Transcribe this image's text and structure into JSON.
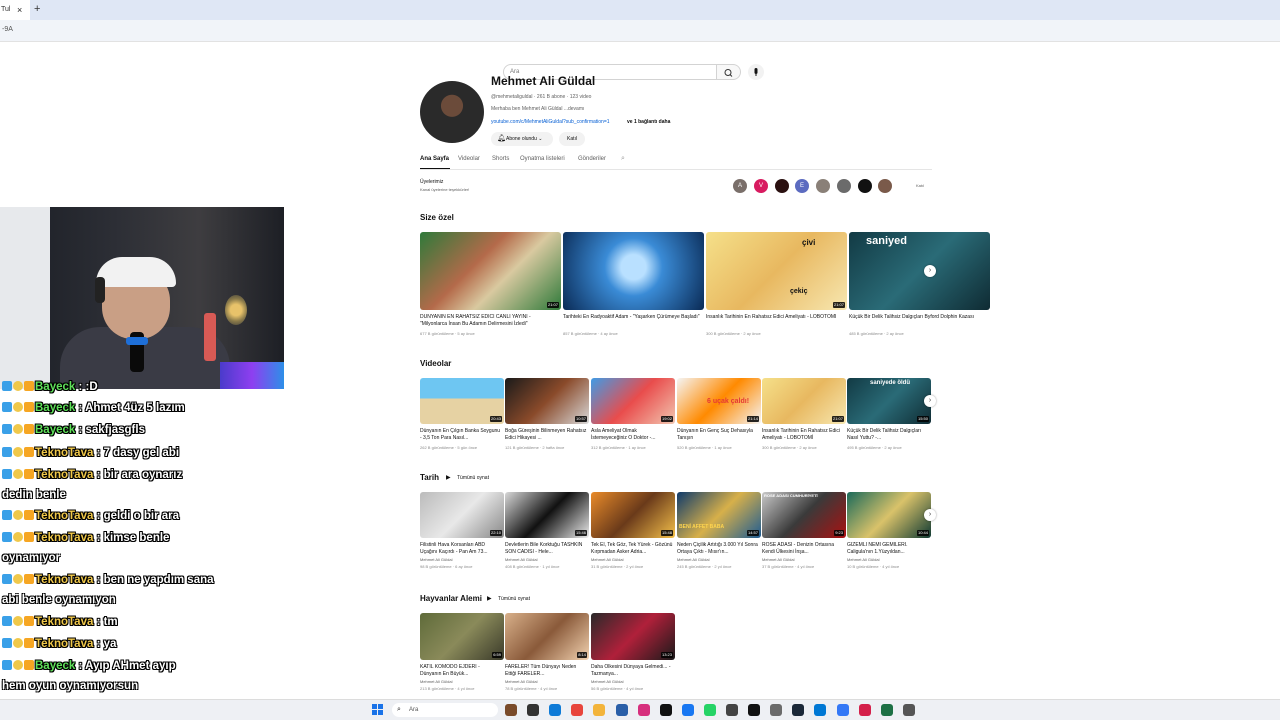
{
  "browser": {
    "tab_title": "Tul",
    "tab_close": "×",
    "new_tab": "+",
    "address": "-9A"
  },
  "youtube": {
    "search_placeholder": "Ara",
    "channel": {
      "name": "Mehmet Ali Güldal",
      "meta": "@mehmetaliguldal · 261 B abone · 123 video",
      "description": "Merhaba ben Mehmet Ali Güldal ...devamı",
      "link": "youtube.com/c/MehmetAliGuldal?sub_confirmation=1",
      "link_more": "ve 1 bağlantı daha",
      "subscribe_label": "Abone olundu",
      "join_label": "Katıl"
    },
    "tabs": [
      "Ana Sayfa",
      "Videolar",
      "Shorts",
      "Oynatma listeleri",
      "Gönderiler"
    ],
    "members": {
      "title": "Üyelerimiz",
      "subtitle": "Kanal üyelerine teşekkürler!",
      "join": "Katıl",
      "avatars": [
        {
          "letter": "A",
          "color": "#7a6f6a"
        },
        {
          "letter": "V",
          "color": "#d81b60"
        },
        {
          "letter": "",
          "color": "#2a1010"
        },
        {
          "letter": "E",
          "color": "#5c6bc0"
        },
        {
          "letter": "",
          "color": "#8a8078"
        },
        {
          "letter": "",
          "color": "#6b6b6b"
        },
        {
          "letter": "",
          "color": "#111111"
        },
        {
          "letter": "",
          "color": "#7a5a4a"
        }
      ]
    },
    "sections": [
      {
        "title": "Size özel",
        "play_all": "",
        "videos": [
          {
            "title": "DÜNYANIN EN RAHATSIZ EDİCİ CANLI YAYINI - \"Milyonlarca İnsan Bu Adamın Delirmesini İzledi\"",
            "meta": "677 B görüntüleme · 5 ay önce",
            "duration": "21:07",
            "channel": ""
          },
          {
            "title": "Tarihteki En Radyoaktif Adam - \"Yaşarken Çürümeye Başladı\"",
            "meta": "857 B görüntüleme · 4 ay önce",
            "duration": "",
            "channel": ""
          },
          {
            "title": "İnsanlık Tarihinin En Rahatsız Edici Ameliyatı - LOBOTOMİ",
            "meta": "300 B görüntüleme · 2 ay önce",
            "duration": "21:07",
            "channel": ""
          },
          {
            "title": "Küçük Bir Delik Talihsiz Dalgıçları Byford Dolphin Kazası",
            "meta": "485 B görüntüleme · 2 ay önce",
            "duration": "",
            "channel": ""
          }
        ]
      },
      {
        "title": "Videolar",
        "play_all": "",
        "videos": [
          {
            "title": "Dünyanın En Çılgın Banka Soygunu - 3,5 Ton Para Nasıl...",
            "meta": "262 B görüntüleme · 5 gün önce",
            "duration": "20:43",
            "channel": ""
          },
          {
            "title": "Boğa Güreşinin Bilinmeyen Rahatsız Edici Hikayesi ...",
            "meta": "121 B görüntüleme · 2 hafta önce",
            "duration": "10:57",
            "channel": ""
          },
          {
            "title": "Asla Ameliyat Olmak İstemeyeceğiniz O Doktor -...",
            "meta": "312 B görüntüleme · 1 ay önce",
            "duration": "19:02",
            "channel": ""
          },
          {
            "title": "Dünyanın En Genç Suç Dehasıyla Tanışın",
            "meta": "520 B görüntüleme · 1 ay önce",
            "duration": "21:14",
            "channel": ""
          },
          {
            "title": "İnsanlık Tarihinin En Rahatsız Edici Ameliyatı - LOBOTOMİ",
            "meta": "300 B görüntüleme · 2 ay önce",
            "duration": "21:07",
            "channel": ""
          },
          {
            "title": "Küçük Bir Delik Talihsiz Dalgıçları Nasıl Yuttu? -...",
            "meta": "495 B görüntüleme · 2 ay önce",
            "duration": "15:50",
            "channel": ""
          }
        ]
      },
      {
        "title": "Tarih",
        "play_all": "Tümünü oynat",
        "videos": [
          {
            "title": "Filistinli Hava Korsanları ABD Uçağını Kaçırdı - Pan Am 73...",
            "meta": "98 B görüntüleme · 6 ay önce",
            "duration": "22:10",
            "channel": "Mehmet Ali Güldal"
          },
          {
            "title": "Devletlerin Bile Korktuğu TASHKIN SON CADISI - Hele...",
            "meta": "408 B görüntüleme · 1 yıl önce",
            "duration": "15:46",
            "channel": "Mehmet Ali Güldal"
          },
          {
            "title": "Tek El, Tek Göz, Tek Yürek - Gözünü Kırpmadan Asker Adria...",
            "meta": "31 B görüntüleme · 2 yıl önce",
            "duration": "15:48",
            "channel": "Mehmet Ali Güldal"
          },
          {
            "title": "Neden Çiçilik Artıtığı 3.000 Yıl Sonra Ortaya Çıktı - Mısır'ın...",
            "meta": "245 B görüntüleme · 2 yıl önce",
            "duration": "14:57",
            "channel": "Mehmet Ali Güldal"
          },
          {
            "title": "ROSE ADASI - Denizin Ortasına Kendi Ülkesini İnşa...",
            "meta": "37 B görüntüleme · 4 yıl önce",
            "duration": "9:23",
            "channel": "Mehmet Ali Güldal"
          },
          {
            "title": "GİZEMLİ NEMİ GEMİLERİ. Caligula'nın 1.Yüzyıldan...",
            "meta": "10 B görüntüleme · 4 yıl önce",
            "duration": "10:44",
            "channel": "Mehmet Ali Güldal"
          }
        ]
      },
      {
        "title": "Hayvanlar Alemi",
        "play_all": "Tümünü oynat",
        "videos": [
          {
            "title": "KATİL KOMODO EJDERİ - Dünyanın En Büyük...",
            "meta": "213 B görüntüleme · 4 yıl önce",
            "duration": "6:59",
            "channel": "Mehmet Ali Güldal"
          },
          {
            "title": "FARELER! Tüm Dünyayı Neden Ettiği FARELER...",
            "meta": "78 B görüntüleme · 4 yıl önce",
            "duration": "8:14",
            "channel": "Mehmet Ali Güldal"
          },
          {
            "title": "Daha Ölkesini Dünyaya Gelmedi... - Tazmanya...",
            "meta": "56 B görüntüleme · 4 yıl önce",
            "duration": "13:23",
            "channel": "Mehmet Ali Güldal"
          }
        ]
      }
    ],
    "thumb_texts": {
      "saniyed": "saniyed",
      "civi": "çivi",
      "cekic": "çekiç",
      "ucak": "6 uçak çaldı!",
      "saniyede_oldu": "saniyede öldü",
      "beni_affet": "BENİ AFFET BABA",
      "rose": "ROSE ADASI CUMHURİYETİ"
    }
  },
  "chat": {
    "lines": [
      {
        "nick": "Bayeck",
        "nick_color": "green",
        "text": " : :D",
        "cont": ""
      },
      {
        "nick": "Bayeck",
        "nick_color": "green",
        "text": " : Ahmet 4üz 5 lazım",
        "cont": ""
      },
      {
        "nick": "Bayeck",
        "nick_color": "green",
        "text": " : sakfjasgfls",
        "cont": ""
      },
      {
        "nick": "TeknoTava",
        "nick_color": "yellow",
        "text": " : 7 dasy gel abi",
        "cont": ""
      },
      {
        "nick": "TeknoTava",
        "nick_color": "yellow",
        "text": " : bir ara oynarız",
        "cont": "dedin benle"
      },
      {
        "nick": "TeknoTava",
        "nick_color": "yellow",
        "text": " : geldi o bir ara",
        "cont": ""
      },
      {
        "nick": "TeknoTava",
        "nick_color": "yellow",
        "text": " : kimse benle",
        "cont": "oynamıyor"
      },
      {
        "nick": "TeknoTava",
        "nick_color": "yellow",
        "text": " : ben ne yapdım sana",
        "cont": "abi benle oynamıyon"
      },
      {
        "nick": "TeknoTava",
        "nick_color": "yellow",
        "text": " : tm",
        "cont": ""
      },
      {
        "nick": "TeknoTava",
        "nick_color": "yellow",
        "text": " : ya",
        "cont": ""
      },
      {
        "nick": "Bayeck",
        "nick_color": "green",
        "text": " : Ayıp AHmet ayıp",
        "cont": "hem oyun oynamıyorsun"
      },
      {
        "nick": "Bayeck",
        "nick_color": "green",
        "text": " : :/",
        "cont": ""
      }
    ]
  },
  "taskbar": {
    "search_placeholder": "Ara",
    "icons": [
      "file-explorer-icon",
      "terminal-icon",
      "edge-icon",
      "chrome-icon",
      "folder-icon",
      "calculator-icon",
      "instagram-icon",
      "tiktok-icon",
      "facebook-icon",
      "whatsapp-icon",
      "app-icon",
      "x-icon",
      "settings-icon",
      "steam-icon",
      "store-icon",
      "vpn-icon",
      "media-icon",
      "excel-icon",
      "gear-icon"
    ],
    "icon_colors": [
      "#7a4b2a",
      "#333333",
      "#0f7bd7",
      "#e8453c",
      "#f3b43b",
      "#2a5fa8",
      "#d62f7d",
      "#111111",
      "#1877f2",
      "#25d366",
      "#444444",
      "#111111",
      "#6b6b6b",
      "#1b2838",
      "#0078d4",
      "#3478f6",
      "#d4204a",
      "#1d7044",
      "#555555"
    ]
  }
}
